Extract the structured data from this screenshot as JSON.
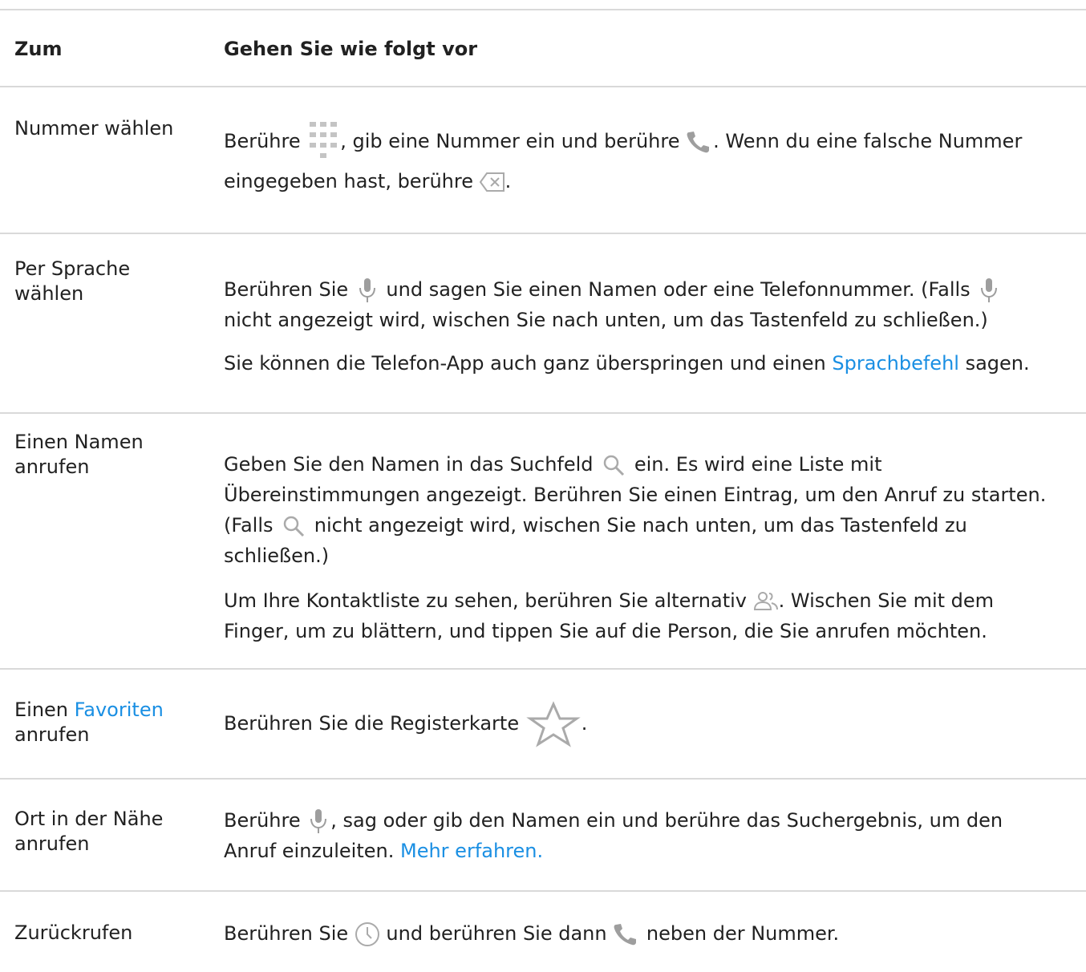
{
  "header": {
    "col1": "Zum",
    "col2": "Gehen Sie wie folgt vor"
  },
  "rows": [
    {
      "action": "Nummer wählen",
      "p1": {
        "t1": "Berühre",
        "t2": ", gib eine Nummer ein und berühre",
        "t3": ". Wenn du eine falsche Nummer",
        "t4": "eingegeben hast, berühre",
        "t5": "."
      }
    },
    {
      "action": "Per Sprache wählen",
      "p1": {
        "t1": "Berühren Sie",
        "t2": "und sagen Sie einen Namen oder eine Telefonnummer. (Falls",
        "t3": "nicht angezeigt wird, wischen Sie nach unten, um das Tastenfeld zu schließen.)"
      },
      "p2": {
        "t1": "Sie können die Telefon-App auch ganz überspringen und einen",
        "link": "Sprachbefehl",
        "t2": "sagen."
      }
    },
    {
      "action": "Einen Namen anrufen",
      "p1": {
        "t1": "Geben Sie den Namen in das Suchfeld",
        "t2": "ein. Es wird eine Liste mit",
        "t3": "Übereinstimmungen angezeigt. Berühren Sie einen Eintrag, um den Anruf zu starten.",
        "t4": "(Falls",
        "t5": "nicht angezeigt wird, wischen Sie nach unten, um das Tastenfeld zu",
        "t6": "schließen.)"
      },
      "p2": {
        "t1": "Um Ihre Kontaktliste zu sehen, berühren Sie alternativ",
        "t2": ". Wischen Sie mit dem",
        "t3": "Finger, um zu blättern, und tippen Sie auf die Person, die Sie anrufen möchten."
      }
    },
    {
      "action_prefix": "Einen",
      "action_link": "Favoriten",
      "action_suffix": "anrufen",
      "p1": {
        "t1": "Berühren Sie die Registerkarte",
        "t2": "."
      }
    },
    {
      "action": "Ort in der Nähe anrufen",
      "p1": {
        "t1": "Berühre",
        "t2": ", sag oder gib den Namen ein und berühre das Suchergebnis, um den",
        "t3": "Anruf einzuleiten.",
        "link": "Mehr erfahren."
      }
    },
    {
      "action": "Zurückrufen",
      "p1": {
        "t1": "Berühren Sie",
        "t2": "und berühren Sie dann",
        "t3": "neben der Nummer."
      }
    }
  ],
  "colors": {
    "link": "#1a8fe3",
    "divider": "#d9d9d9",
    "icon": "#9e9e9e",
    "text": "#212121"
  },
  "icons": [
    "dialpad-icon",
    "phone-icon",
    "backspace-icon",
    "mic-icon",
    "search-icon",
    "contacts-icon",
    "star-icon",
    "clock-icon"
  ]
}
